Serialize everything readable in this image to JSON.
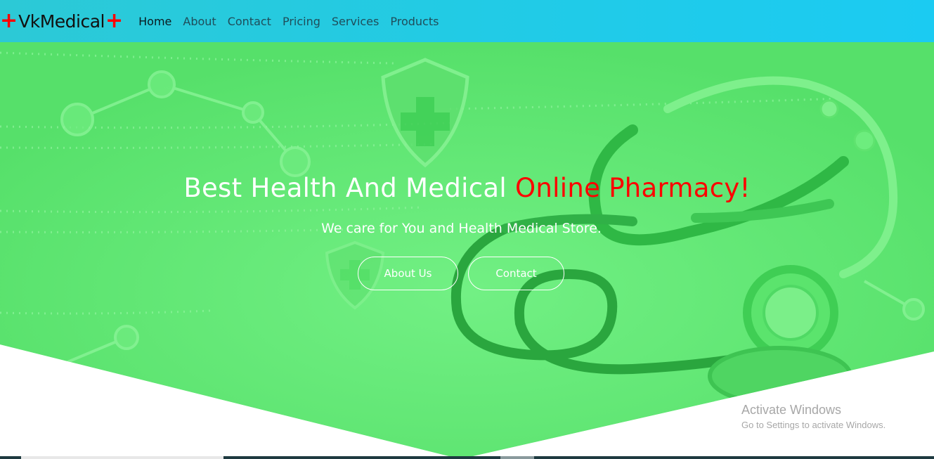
{
  "brand": {
    "prefix_icon": "+",
    "name": "VkMedical",
    "suffix_icon": "+",
    "icon_color": "#ff0000"
  },
  "nav": {
    "items": [
      "Home",
      "About",
      "Contact",
      "Pricing",
      "Services",
      "Products"
    ],
    "active": "Home"
  },
  "hero": {
    "title_main": "Best Health And Medical ",
    "title_accent": "Online Pharmacy!",
    "subtitle": "We care for You and Health Medical Store.",
    "buttons": {
      "about": "About Us",
      "contact": "Contact"
    },
    "background_icons": [
      "shield-cross-icon",
      "stethoscope-icon",
      "molecule-icon"
    ]
  },
  "watermark": {
    "title": "Activate Windows",
    "subtitle": "Go to Settings to activate Windows."
  },
  "colors": {
    "navbar": "#22cbe5",
    "hero": "#5fe872",
    "accent": "#ff0000"
  }
}
